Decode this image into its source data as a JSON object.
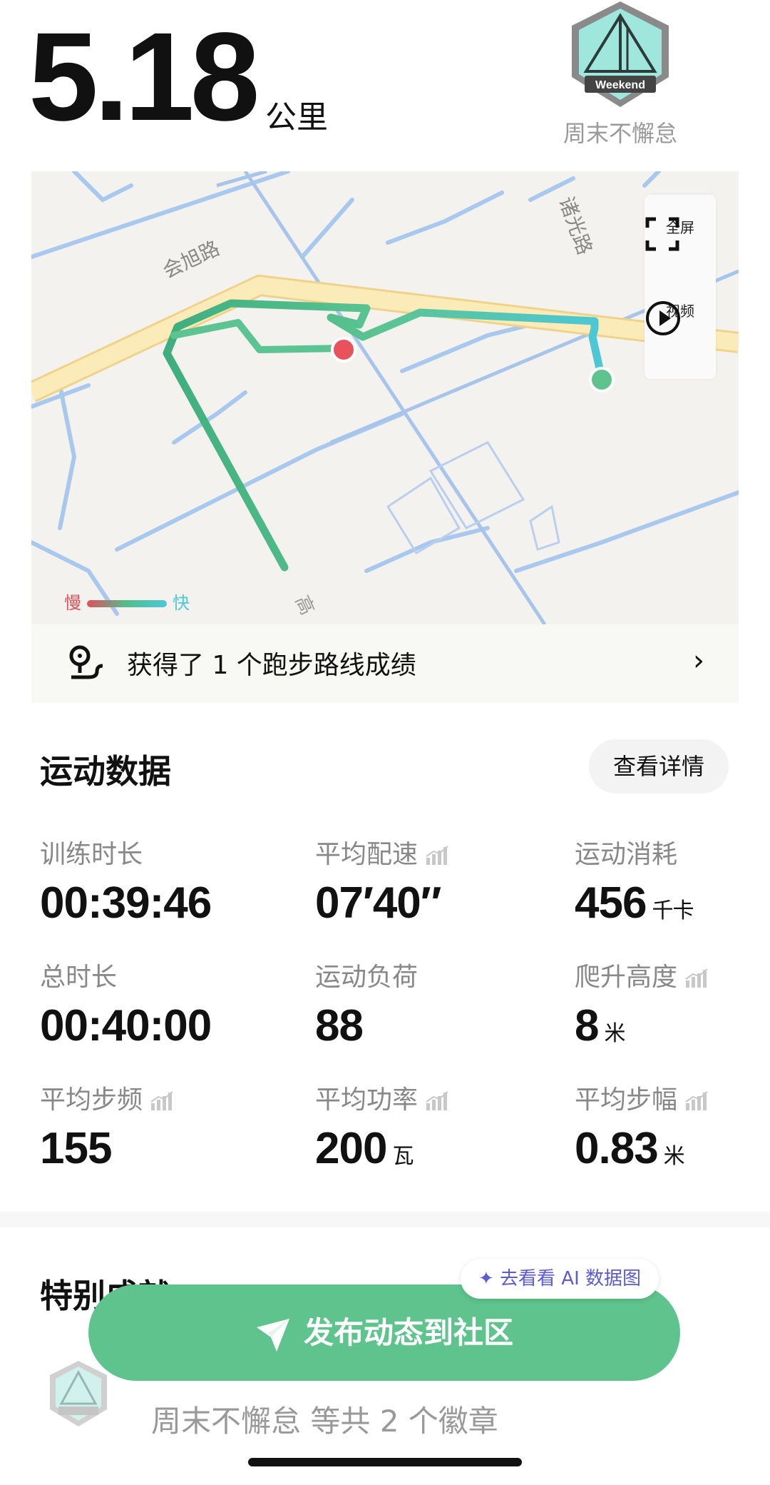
{
  "header": {
    "distance_value": "5.18",
    "distance_unit": "公里",
    "badge_text": "Weekend",
    "badge_name": "周末不懈怠"
  },
  "map": {
    "labels": [
      "会旭路",
      "诸光路",
      "高"
    ],
    "controls": {
      "fullscreen_label": "全屏",
      "video_label": "视频"
    },
    "legend": {
      "slow_label": "慢",
      "fast_label": "快"
    },
    "colors": {
      "route_slow": "#e0505a",
      "route_mid": "#4fbf8f",
      "route_fast": "#4ec7d6",
      "start_marker": "#e9525a",
      "end_marker": "#5ec38c"
    }
  },
  "route_banner": {
    "text": "获得了 1 个跑步路线成绩",
    "icon": "route-pin-icon"
  },
  "stats_section": {
    "title": "运动数据",
    "details_button": "查看详情",
    "items": [
      {
        "label": "训练时长",
        "value": "00:39:46",
        "unit": "",
        "trend": false
      },
      {
        "label": "平均配速",
        "value": "07′40″",
        "unit": "",
        "trend": true
      },
      {
        "label": "运动消耗",
        "value": "456",
        "unit": "千卡",
        "trend": false
      },
      {
        "label": "总时长",
        "value": "00:40:00",
        "unit": "",
        "trend": false
      },
      {
        "label": "运动负荷",
        "value": "88",
        "unit": "",
        "trend": false
      },
      {
        "label": "爬升高度",
        "value": "8",
        "unit": "米",
        "trend": true
      },
      {
        "label": "平均步频",
        "value": "155",
        "unit": "",
        "trend": true
      },
      {
        "label": "平均功率",
        "value": "200",
        "unit": "瓦",
        "trend": true
      },
      {
        "label": "平均步幅",
        "value": "0.83",
        "unit": "米",
        "trend": true
      }
    ]
  },
  "achievements": {
    "title": "特别成就",
    "ai_button": "去看看 AI 数据图",
    "summary": "周末不懈怠 等共 2 个徽章"
  },
  "publish_button": "发布动态到社区",
  "colors": {
    "accent_green": "#5ec38c",
    "ai_purple": "#5b5bd6"
  }
}
